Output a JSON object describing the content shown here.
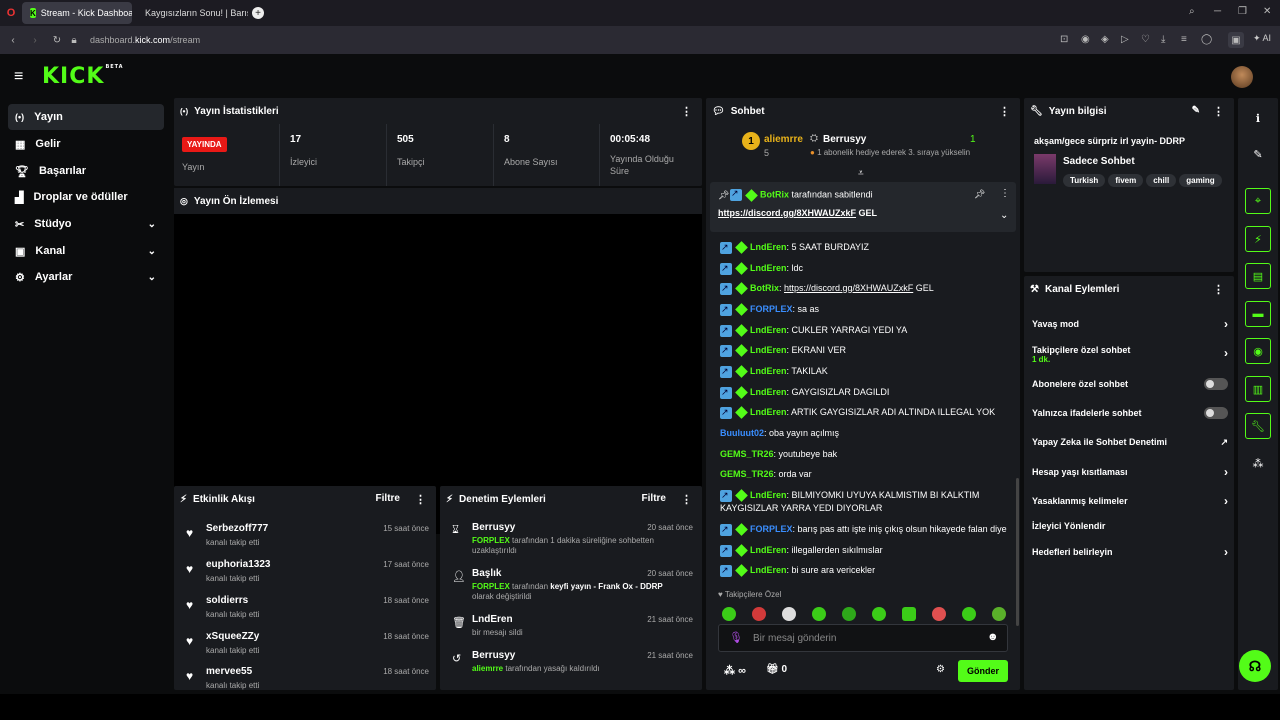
{
  "browser": {
    "tabs": [
      {
        "title": "Stream - Kick Dashboard"
      },
      {
        "title": "Kaygısızların Sonu! | Barış’"
      }
    ],
    "url_prefix": "dashboard.",
    "url_host": "kick.com",
    "url_path": "/stream",
    "ai_label": "AI"
  },
  "brand": {
    "logo": "KICK",
    "beta": "BETA",
    "accent": "#53fc18"
  },
  "sidebar": {
    "items": [
      {
        "label": "Yayın",
        "icon": "broadcast-icon"
      },
      {
        "label": "Gelir",
        "icon": "revenue-icon"
      },
      {
        "label": "Başarılar",
        "icon": "trophy-icon"
      },
      {
        "label": "Droplar ve ödüller",
        "icon": "drops-icon"
      },
      {
        "label": "Stüdyo",
        "icon": "studio-icon"
      },
      {
        "label": "Kanal",
        "icon": "channel-icon"
      },
      {
        "label": "Ayarlar",
        "icon": "settings-icon"
      }
    ]
  },
  "stats": {
    "title": "Yayın İstatistikleri",
    "live_badge": "YAYINDA",
    "live_label": "Yayın",
    "viewers_value": "17",
    "viewers_label": "İzleyici",
    "followers_value": "505",
    "followers_label": "Takipçi",
    "subs_value": "8",
    "subs_label": "Abone Sayısı",
    "uptime_value": "00:05:48",
    "uptime_label": "Yayında Olduğu Süre"
  },
  "preview": {
    "title": "Yayın Ön İzlemesi"
  },
  "activity": {
    "title": "Etkinlik Akışı",
    "filter": "Filtre",
    "items": [
      {
        "name": "Serbezoff777",
        "action": "kanalı takip etti",
        "time": "15 saat önce"
      },
      {
        "name": "euphoria1323",
        "action": "kanalı takip etti",
        "time": "17 saat önce"
      },
      {
        "name": "soldierrs",
        "action": "kanalı takip etti",
        "time": "18 saat önce"
      },
      {
        "name": "xSqueeZZy",
        "action": "kanalı takip etti",
        "time": "18 saat önce"
      },
      {
        "name": "mervee55",
        "action": "kanalı takip etti",
        "time": "18 saat önce"
      }
    ]
  },
  "moderation": {
    "title": "Denetim Eylemleri",
    "filter": "Filtre",
    "items": [
      {
        "title": "Berrusyy",
        "actor": "FORPLEX",
        "text": "tarafından 1 dakika süreliğine sohbetten uzaklaştırıldı",
        "time": "20 saat önce"
      },
      {
        "title": "Başlık",
        "actor": "FORPLEX",
        "text": "tarafından",
        "bold": "keyfi yayın - Frank Ox - DDRP",
        "text2": "olarak değiştirildi",
        "time": "20 saat önce"
      },
      {
        "title": "LndEren",
        "text": "bir mesajı sildi",
        "time": "21 saat önce"
      },
      {
        "title": "Berrusyy",
        "actor": "aliemrre",
        "text": "tarafından yasağı kaldırıldı",
        "time": "21 saat önce"
      }
    ]
  },
  "chat": {
    "title": "Sohbet",
    "top_user": "aliemrre",
    "top_user_count": "5",
    "top_user2": "Berrusyy",
    "top_user2_count": "1",
    "gift_text": "1 abonelik hediye ederek 3. sıraya yükselin",
    "pinned_user": "BotRix",
    "pinned_by": "tarafından sabitlendi",
    "pinned_link": "https://discord.gg/8XHWAUZxkF",
    "pinned_suffix": "GEL",
    "messages": [
      {
        "user": "LndEren",
        "text": "5 SAAT BURDAYIZ",
        "badges": true
      },
      {
        "user": "LndEren",
        "text": "ldc",
        "badges": true
      },
      {
        "user": "BotRix",
        "text": "https://discord.gg/8XHWAUZxkF",
        "suffix": "GEL",
        "badges": true,
        "link": true
      },
      {
        "user": "FORPLEX",
        "text": "sa as",
        "badges": true,
        "blue": true
      },
      {
        "user": "LndEren",
        "text": "CUKLER YARRAGI YEDI YA",
        "badges": true
      },
      {
        "user": "LndEren",
        "text": "EKRANI VER",
        "badges": true
      },
      {
        "user": "LndEren",
        "text": "TAKILAK",
        "badges": true
      },
      {
        "user": "LndEren",
        "text": "GAYGISIZLAR DAGILDI",
        "badges": true
      },
      {
        "user": "LndEren",
        "text": "ARTIK GAYGISIZLAR ADI ALTINDA ILLEGAL YOK",
        "badges": true
      },
      {
        "user": "Buuluut02",
        "text": "oba yayın açılmış",
        "badges": false,
        "blue": true
      },
      {
        "user": "GEMS_TR26",
        "text": "youtubeye bak",
        "badges": false
      },
      {
        "user": "GEMS_TR26",
        "text": "orda var",
        "badges": false
      },
      {
        "user": "LndEren",
        "text": "BILMIYOMKI UYUYA KALMISTIM BI KALKTIM KAYGISIZLAR YARRA YEDI DIYORLAR",
        "badges": true
      },
      {
        "user": "FORPLEX",
        "text": "barış pas attı işte iniş çıkış olsun hikayede falan diye",
        "badges": true,
        "blue": true
      },
      {
        "user": "LndEren",
        "text": "illegallerden sıkılmıslar",
        "badges": true
      },
      {
        "user": "LndEren",
        "text": "bi sure ara vericekler",
        "badges": true
      }
    ],
    "followers_only": "Takipçilere Özel",
    "input_placeholder": "Bir mesaj gönderin",
    "points": "∞",
    "gifts": "0",
    "send": "Gönder"
  },
  "stream_info": {
    "title": "Yayın bilgisi",
    "stream_title": "akşam/gece sürpriz irl yayin- DDRP",
    "category": "Sadece Sohbet",
    "tags": [
      "Turkish",
      "fivem",
      "chill",
      "gaming"
    ]
  },
  "channel_actions": {
    "title": "Kanal Eylemleri",
    "items": [
      {
        "label": "Yavaş mod",
        "type": "arrow"
      },
      {
        "label": "Takipçilere özel sohbet",
        "sub": "1 dk.",
        "type": "arrow"
      },
      {
        "label": "Abonelere özel sohbet",
        "type": "toggle"
      },
      {
        "label": "Yalnızca ifadelerle sohbet",
        "type": "toggle"
      },
      {
        "label": "Yapay Zeka ile Sohbet Denetimi",
        "type": "external"
      },
      {
        "label": "Hesap yaşı kısıtlaması",
        "type": "arrow"
      },
      {
        "label": "Yasaklanmış kelimeler",
        "type": "arrow"
      },
      {
        "label": "İzleyici Yönlendir",
        "type": "none"
      },
      {
        "label": "Hedefleri belirleyin",
        "type": "arrow"
      }
    ]
  }
}
